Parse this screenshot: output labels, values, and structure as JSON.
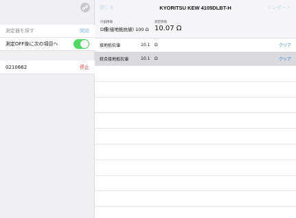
{
  "sidebar": {
    "link_icon": "link-icon",
    "search_row": {
      "label": "測定器を探す",
      "action": "開始"
    },
    "toggle_row": {
      "label": "測定OFF後に次の項目へ",
      "on": true
    },
    "device_row": {
      "id": "0210662",
      "action": "停止"
    }
  },
  "topbar": {
    "close_label": "閉じる",
    "title": "KYORITSU KEW 4105DLBT-H",
    "import_label": "インポート"
  },
  "info": {
    "plan_caption": "計画情報",
    "plan_value": "D種(接地抵抗値) 100 Ω",
    "measure_caption": "測定情報",
    "measure_value": "10.07 Ω"
  },
  "rows": [
    {
      "label": "接地抵抗値",
      "value": "10.1",
      "unit": "Ω",
      "action": "クリア"
    },
    {
      "label": "統合接地抵抗値",
      "value": "10.1",
      "unit": "Ω",
      "action": "クリア"
    }
  ],
  "colors": {
    "accent": "#2b7de1",
    "toggle_on": "#4cd964",
    "stop": "#e0352b",
    "selected_row": "#d9d9de"
  }
}
